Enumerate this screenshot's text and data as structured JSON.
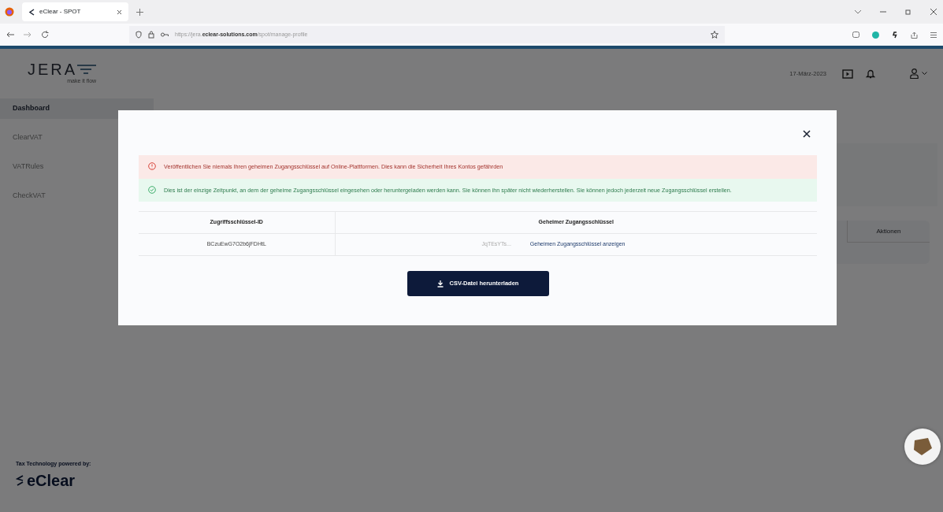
{
  "browser": {
    "tab_title": "eClear - SPOT",
    "url": "https://jera.**eclear-solutions.com**/spot/manage-profile"
  },
  "header": {
    "logo": "JERA",
    "tagline": "make it flow",
    "date": "17-März-2023"
  },
  "sidebar": {
    "items": [
      {
        "label": "Dashboard",
        "selected": true
      },
      {
        "label": "ClearVAT",
        "selected": false
      },
      {
        "label": "VATRules",
        "selected": false
      },
      {
        "label": "CheckVAT",
        "selected": false
      }
    ],
    "powered_by": "Tax Technology powered by:",
    "brand": "eClear"
  },
  "background_table": {
    "columns": [
      "Aktionen"
    ]
  },
  "modal": {
    "alerts": [
      {
        "kind": "danger",
        "text": "Veröffentlichen Sie niemals Ihren geheimen Zugangsschlüssel auf Online-Plattformen. Dies kann die Sicherheit Ihres Kontos gefährden"
      },
      {
        "kind": "success",
        "text": "Dies ist der einzige Zeitpunkt, an dem der geheime Zugangsschlüssel eingesehen oder heruntergeladen werden kann. Sie können ihn später nicht wiederherstellen. Sie können jedoch jederzeit neue Zugangsschlüssel erstellen."
      }
    ],
    "table": {
      "columns": [
        "Zugriffsschlüssel-ID",
        "Geheimer Zugangsschlüssel"
      ],
      "rows": [
        {
          "id": "BCzuEwG7O2b6jFDHtL",
          "secret": "JqTEsYTs...",
          "link": "Geheimen Zugangsschlüssel anzeigen"
        }
      ]
    },
    "button": "CSV-Datei herunterladen"
  }
}
